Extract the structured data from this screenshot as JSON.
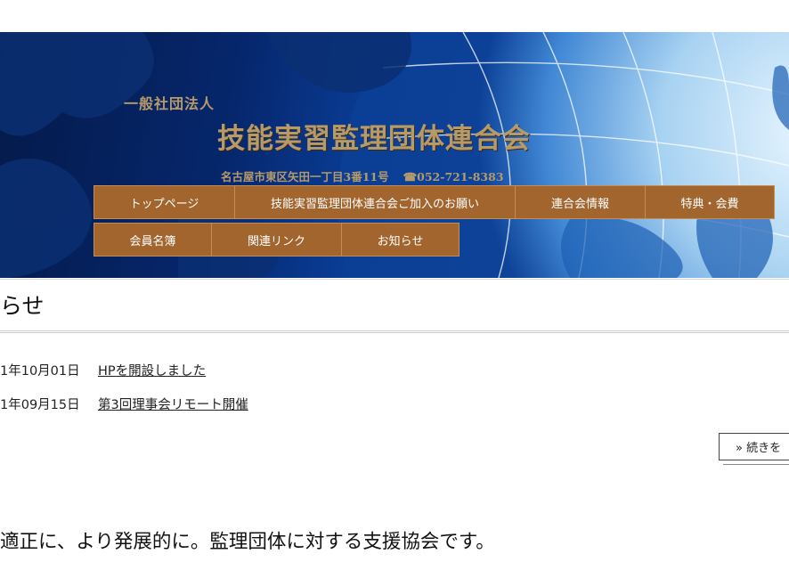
{
  "header": {
    "org_type": "一般社団法人",
    "org_name": "技能実習監理団体連合会",
    "address": "名古屋市東区矢田一丁目3番11号",
    "tel": "☎052-721-8383"
  },
  "nav": {
    "items": [
      {
        "label": "トップページ"
      },
      {
        "label": "技能実習監理団体連合会ご加入のお願い"
      },
      {
        "label": "連合会情報"
      },
      {
        "label": "特典・会費"
      },
      {
        "label": "会員名簿"
      },
      {
        "label": "関連リンク"
      },
      {
        "label": "お知らせ"
      }
    ]
  },
  "news": {
    "title": "らせ",
    "items": [
      {
        "date": "1年10月01日",
        "title": "HPを開設しました"
      },
      {
        "date": "1年09月15日",
        "title": "第3回理事会リモート開催"
      }
    ],
    "more_label": "» 続きを"
  },
  "tagline": "適正に、より発展的に。監理団体に対する支援協会です。",
  "colors": {
    "nav_bg": "#a2652e",
    "header_text": "#b79a6a",
    "banner_dark": "#041a4a",
    "banner_light": "#c5e2f7"
  }
}
